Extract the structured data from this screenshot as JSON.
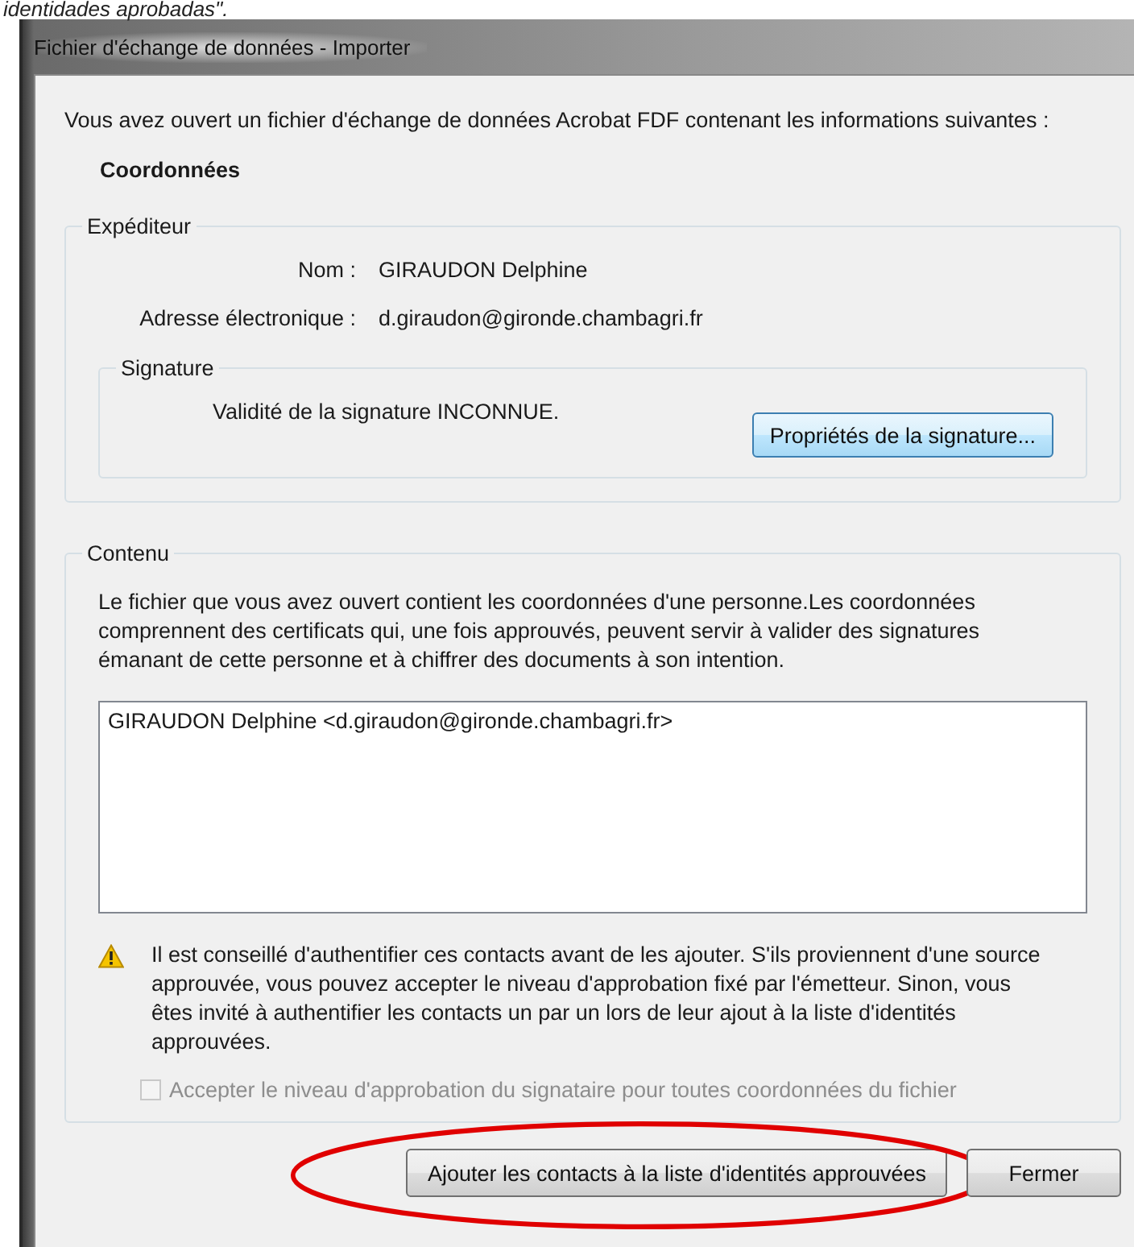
{
  "caption": "identidades aprobadas\".",
  "window": {
    "title": "Fichier d'échange de données - Importer"
  },
  "intro": "Vous avez ouvert un fichier d'échange de données Acrobat FDF contenant les informations suivantes :",
  "section_title": "Coordonnées",
  "sender": {
    "legend": "Expéditeur",
    "fields": [
      {
        "label": "Nom :",
        "value": "GIRAUDON Delphine"
      },
      {
        "label": "Adresse électronique :",
        "value": "d.giraudon@gironde.chambagri.fr"
      }
    ],
    "signature": {
      "legend": "Signature",
      "status": "Validité de la signature INCONNUE.",
      "button": "Propriétés de la signature..."
    }
  },
  "content": {
    "legend": "Contenu",
    "description": "Le fichier que vous avez ouvert contient les coordonnées d'une personne.Les coordonnées comprennent des certificats qui, une fois approuvés, peuvent servir à valider des signatures émanant de cette personne et à chiffrer des documents à son intention.",
    "contacts": [
      {
        "text": "GIRAUDON Delphine <d.giraudon@gironde.chambagri.fr>",
        "selected": false
      }
    ],
    "warning": "Il est conseillé d'authentifier ces contacts avant de les ajouter. S'ils proviennent d'une source approuvée, vous pouvez accepter le niveau d'approbation fixé par l'émetteur. Sinon, vous êtes invité à authentifier les contacts un par un lors de leur ajout à la liste d'identités approuvées.",
    "checkbox": {
      "label": "Accepter le niveau d'approbation du signataire pour toutes coordonnées du fichier",
      "checked": false,
      "disabled": true
    }
  },
  "buttons": [
    {
      "label": "Ajouter les contacts à la liste d'identités approuvées",
      "highlighted": true
    },
    {
      "label": "Fermer",
      "highlighted": false
    }
  ]
}
